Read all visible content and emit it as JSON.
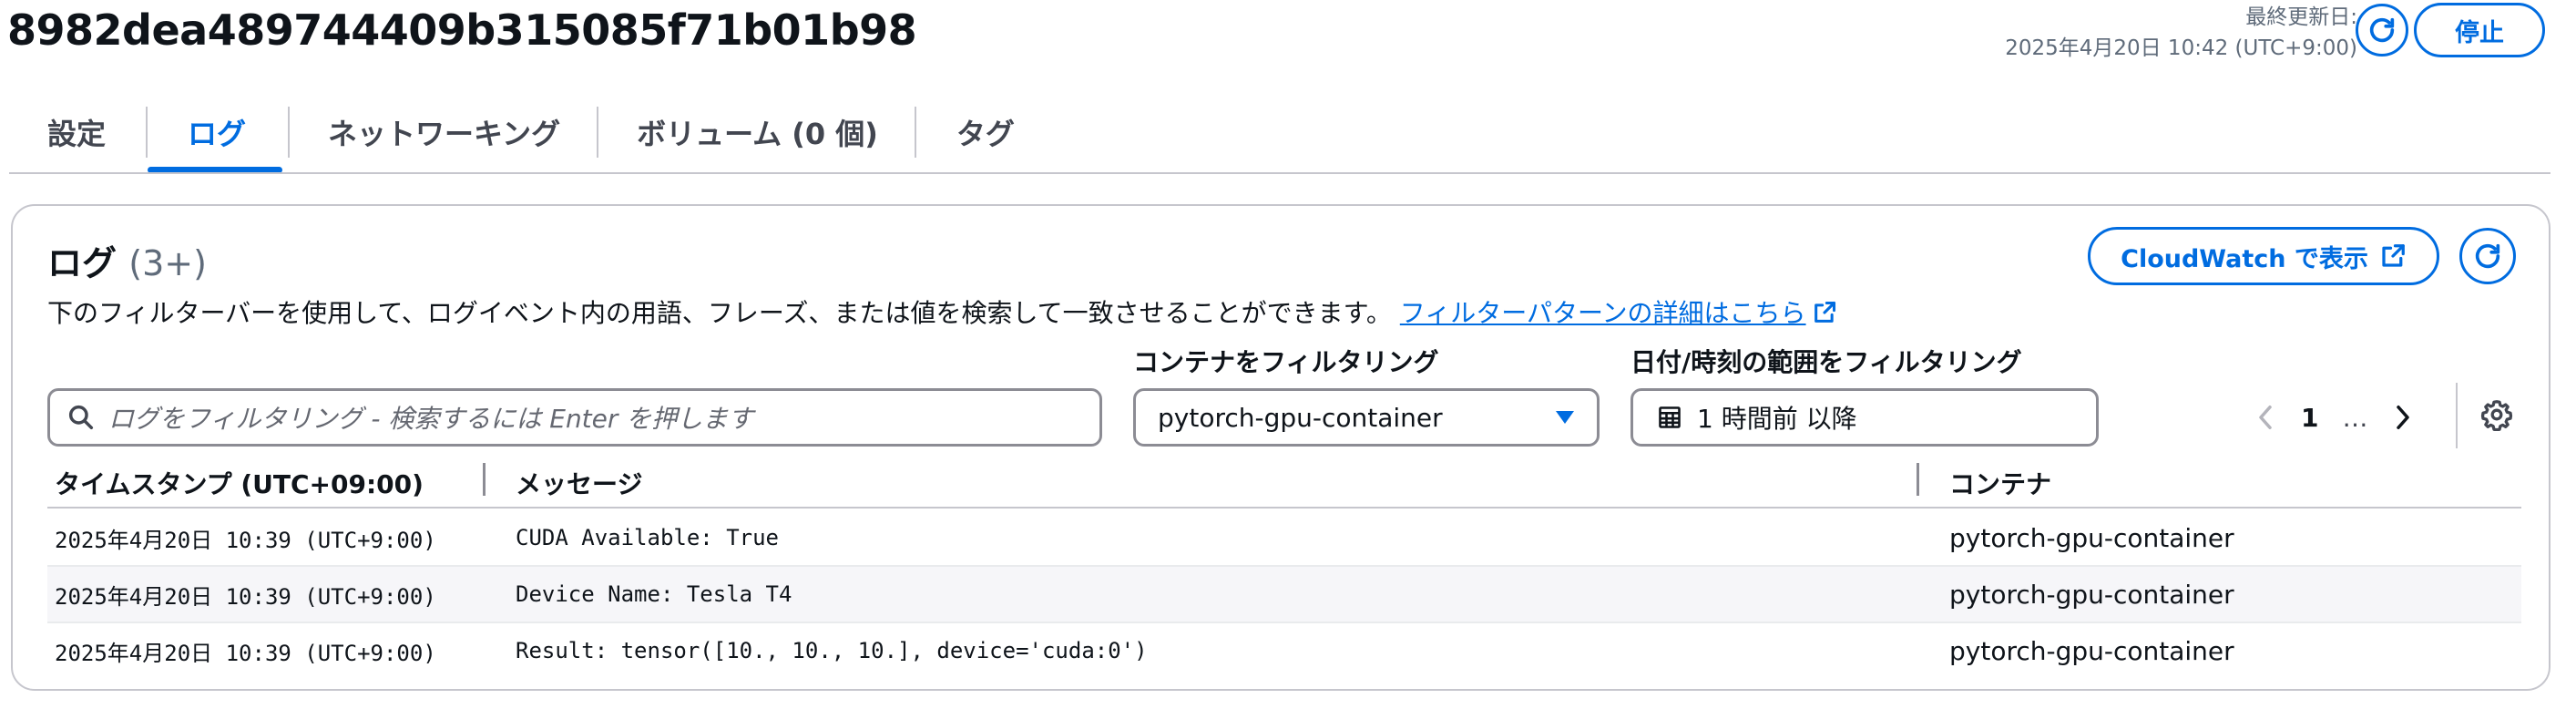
{
  "header": {
    "task_id": "8982dea489744409b315085f71b01b98",
    "updated_label": "最終更新日:",
    "updated_value": "2025年4月20日 10:42 (UTC+9:00)",
    "stop_label": "停止"
  },
  "tabs": [
    {
      "label": "設定",
      "active": false
    },
    {
      "label": "ログ",
      "active": true
    },
    {
      "label": "ネットワーキング",
      "active": false
    },
    {
      "label": "ボリューム (0 個)",
      "active": false
    },
    {
      "label": "タグ",
      "active": false
    }
  ],
  "logs": {
    "title": "ログ",
    "count": "(3+)",
    "description": "下のフィルターバーを使用して、ログイベント内の用語、フレーズ、または値を検索して一致させることができます。",
    "link_text": "フィルターパターンの詳細はこちら",
    "cloudwatch_label": "CloudWatch で表示",
    "search_placeholder": "ログをフィルタリング - 検索するには Enter を押します",
    "container_filter_label": "コンテナをフィルタリング",
    "container_filter_value": "pytorch-gpu-container",
    "date_filter_label": "日付/時刻の範囲をフィルタリング",
    "date_filter_value": "1 時間前 以降",
    "pagination": {
      "current_page": "1",
      "ellipsis": "…"
    },
    "columns": {
      "timestamp": "タイムスタンプ (UTC+09:00)",
      "message": "メッセージ",
      "container": "コンテナ"
    },
    "rows": [
      {
        "timestamp": "2025年4月20日 10:39 (UTC+9:00)",
        "message": "CUDA Available: True",
        "container": "pytorch-gpu-container"
      },
      {
        "timestamp": "2025年4月20日 10:39 (UTC+9:00)",
        "message": "Device Name: Tesla T4",
        "container": "pytorch-gpu-container"
      },
      {
        "timestamp": "2025年4月20日 10:39 (UTC+9:00)",
        "message": "Result: tensor([10., 10., 10.], device='cuda:0')",
        "container": "pytorch-gpu-container"
      }
    ]
  },
  "colors": {
    "accent": "#006ce0",
    "text": "#0f141a",
    "muted": "#5f6b7a",
    "border": "#8c8c94"
  },
  "icons": [
    "refresh-icon",
    "external-link-icon",
    "search-icon",
    "dropdown-caret-icon",
    "calendar-icon",
    "chevron-left-icon",
    "chevron-right-icon",
    "gear-icon"
  ]
}
